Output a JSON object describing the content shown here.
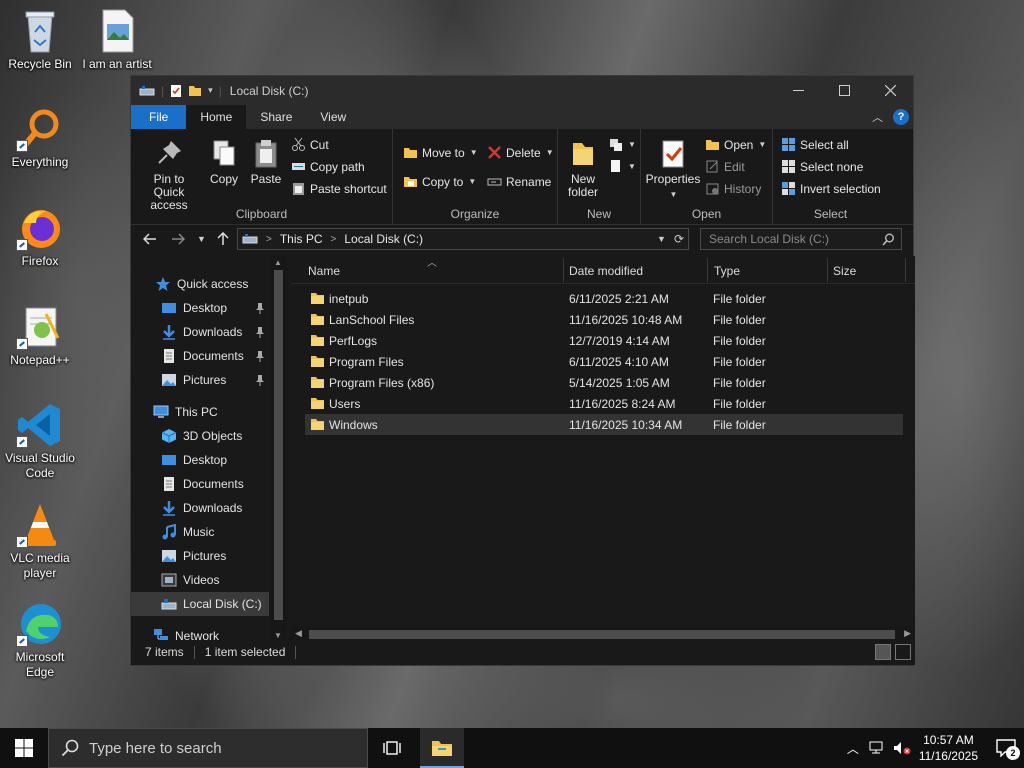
{
  "desktop": {
    "icons": [
      {
        "label": "Recycle Bin",
        "icon": "recycle-bin-icon"
      },
      {
        "label": "I am an artist",
        "icon": "image-file-icon"
      },
      {
        "label": "Everything",
        "icon": "everything-search-icon"
      },
      {
        "label": "Firefox",
        "icon": "firefox-icon"
      },
      {
        "label": "Notepad++",
        "icon": "notepad-plus-plus-icon"
      },
      {
        "label": "Visual Studio Code",
        "icon": "vscode-icon"
      },
      {
        "label": "VLC media player",
        "icon": "vlc-icon"
      },
      {
        "label": "Microsoft Edge",
        "icon": "edge-icon"
      }
    ]
  },
  "window": {
    "title": "Local Disk (C:)",
    "tabs": {
      "file": "File",
      "home": "Home",
      "share": "Share",
      "view": "View"
    },
    "help": "?"
  },
  "ribbon": {
    "clipboard": {
      "label": "Clipboard",
      "pin": "Pin to Quick access",
      "copy": "Copy",
      "paste": "Paste",
      "cut": "Cut",
      "copy_path": "Copy path",
      "paste_shortcut": "Paste shortcut"
    },
    "organize": {
      "label": "Organize",
      "move_to": "Move to",
      "copy_to": "Copy to",
      "delete": "Delete",
      "rename": "Rename"
    },
    "new": {
      "label": "New",
      "new_folder": "New folder"
    },
    "open": {
      "label": "Open",
      "properties": "Properties",
      "open": "Open",
      "edit": "Edit",
      "history": "History"
    },
    "select": {
      "label": "Select",
      "select_all": "Select all",
      "select_none": "Select none",
      "invert": "Invert selection"
    }
  },
  "address": {
    "crumbs": [
      "This PC",
      "Local Disk (C:)"
    ],
    "search_placeholder": "Search Local Disk (C:)"
  },
  "nav": {
    "quick_access": "Quick access",
    "qa_items": [
      "Desktop",
      "Downloads",
      "Documents",
      "Pictures"
    ],
    "this_pc": "This PC",
    "pc_items": [
      "3D Objects",
      "Desktop",
      "Documents",
      "Downloads",
      "Music",
      "Pictures",
      "Videos",
      "Local Disk (C:)"
    ],
    "network": "Network"
  },
  "columns": {
    "name": "Name",
    "date": "Date modified",
    "type": "Type",
    "size": "Size"
  },
  "files": [
    {
      "name": "inetpub",
      "date": "6/11/2025 2:21 AM",
      "type": "File folder"
    },
    {
      "name": "LanSchool Files",
      "date": "11/16/2025 10:48 AM",
      "type": "File folder"
    },
    {
      "name": "PerfLogs",
      "date": "12/7/2019 4:14 AM",
      "type": "File folder"
    },
    {
      "name": "Program Files",
      "date": "6/11/2025 4:10 AM",
      "type": "File folder"
    },
    {
      "name": "Program Files (x86)",
      "date": "5/14/2025 1:05 AM",
      "type": "File folder"
    },
    {
      "name": "Users",
      "date": "11/16/2025 8:24 AM",
      "type": "File folder"
    },
    {
      "name": "Windows",
      "date": "11/16/2025 10:34 AM",
      "type": "File folder"
    }
  ],
  "status": {
    "count": "7 items",
    "selected": "1 item selected"
  },
  "taskbar": {
    "search_placeholder": "Type here to search",
    "time": "10:57 AM",
    "date": "11/16/2025",
    "notifications": "2"
  },
  "colors": {
    "accent": "#1a6fc9",
    "folder": "#f2c14e",
    "window_bg": "#191919"
  }
}
